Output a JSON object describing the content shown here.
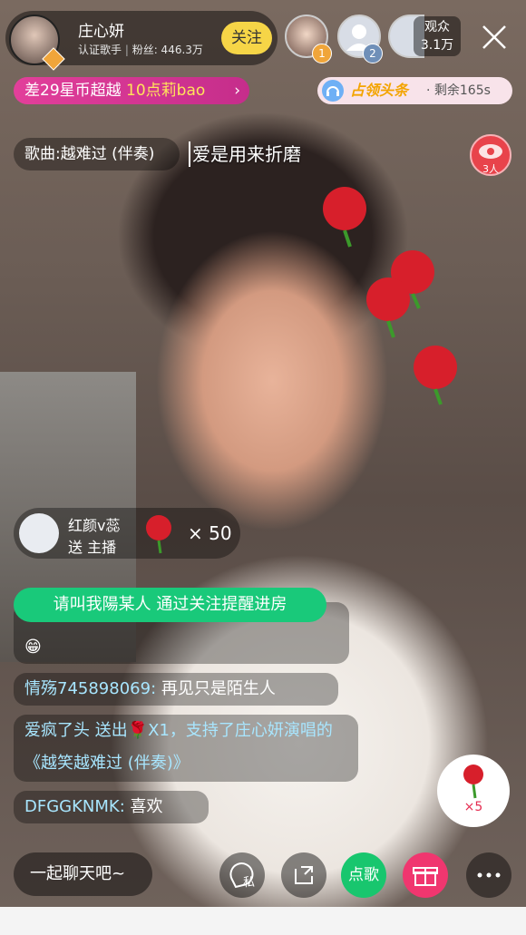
{
  "anchor": {
    "name": "庄心妍",
    "role": "认证歌手",
    "fans_label": "粉丝: 446.3万",
    "follow_label": "关注"
  },
  "viewers": {
    "ranks": [
      "1",
      "2"
    ],
    "count_label": "观众",
    "count_value": "3.1万"
  },
  "banners": {
    "left_text_prefix": "差29星币超越",
    "left_text_name": "10点莉bao",
    "right_headline": "占领头条",
    "right_remaining": "· 剩余165s"
  },
  "song": {
    "label": "歌曲:越难过 (伴奏)",
    "lyric": "爱是用来折磨"
  },
  "red_packet": {
    "count": "3人"
  },
  "gift_banner": {
    "sender": "红颜v蕊",
    "action": "送 主播",
    "multiplier": "× 50"
  },
  "follow_tip": "请叫我陽某人 通过关注提醒进房",
  "chat": [
    {
      "user": "",
      "text": "😁"
    },
    {
      "user": "情殇745898069:",
      "text": " 再见只是陌生人"
    },
    {
      "user": "爱疯了头 送出🌹X1，支持了庄心妍演唱的《越笑越难过 (伴奏)》",
      "text": ""
    },
    {
      "user": "DFGGKNMK:",
      "text": " 喜欢"
    }
  ],
  "bottom_bar": {
    "chat_placeholder": "一起聊天吧~",
    "private_label": "私",
    "song_request_label": "点歌"
  },
  "rose_button": {
    "count": "×5"
  },
  "colors": {
    "accent_yellow": "#f6d547",
    "pink_pill": "#e23f9a",
    "green": "#19c97a",
    "gift_pink": "#f0366f",
    "rose_red": "#e52b50"
  }
}
